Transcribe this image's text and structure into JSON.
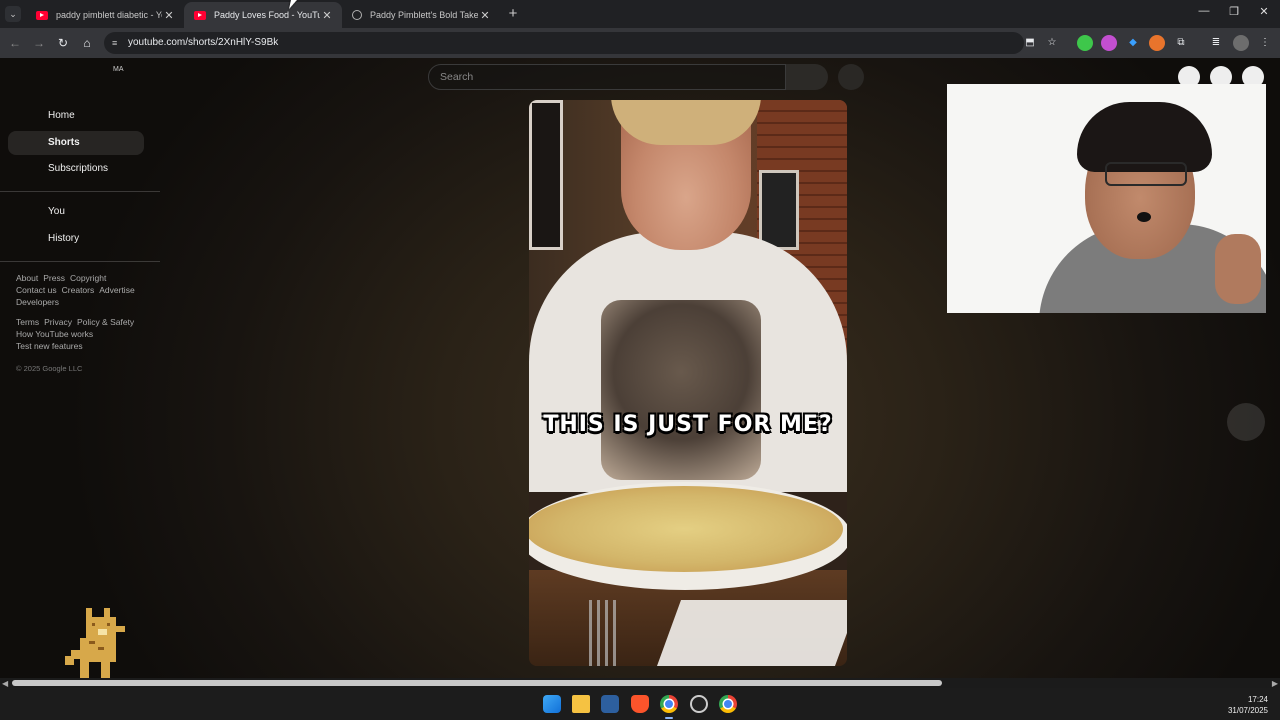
{
  "browser": {
    "tabs": [
      {
        "title": "paddy pimblett diabetic - YouTube",
        "favicon": "youtube-icon",
        "active": false
      },
      {
        "title": "Paddy Loves Food - YouTube",
        "favicon": "youtube-icon",
        "active": true
      },
      {
        "title": "Paddy Pimblett's Bold Take - YouTube",
        "favicon": "globe-icon",
        "active": false
      }
    ],
    "close_glyph": "✕",
    "new_tab_glyph": "+",
    "url": "youtube.com/shorts/2XnHlY-S9Bk",
    "window_controls": {
      "minimize": "—",
      "restore": "❐",
      "close": "✕"
    }
  },
  "youtube": {
    "account_initials": "MA",
    "search_placeholder": "Search",
    "sidebar": {
      "main": [
        "Home",
        "Shorts",
        "Subscriptions"
      ],
      "you": [
        "You",
        "History"
      ],
      "selected": "Shorts"
    },
    "footer": {
      "row1": [
        "About",
        "Press",
        "Copyright"
      ],
      "row2": [
        "Contact us",
        "Creators",
        "Advertise"
      ],
      "row3": [
        "Developers"
      ],
      "row4": [
        "Terms",
        "Privacy",
        "Policy & Safety"
      ],
      "row5": [
        "How YouTube works"
      ],
      "row6": [
        "Test new features"
      ],
      "copyright": "© 2025 Google LLC"
    },
    "video_caption": "THIS IS JUST FOR ME?"
  },
  "taskbar": {
    "time": "17:24",
    "date": "31/07/2025"
  }
}
